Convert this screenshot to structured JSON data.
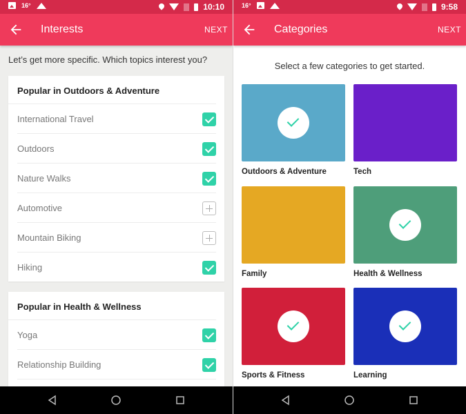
{
  "left_screen": {
    "status": {
      "temperature": "16°",
      "time": "10:10"
    },
    "appbar": {
      "title": "Interests",
      "next_label": "NEXT"
    },
    "prompt": "Let’s get more specific. Which topics interest you?",
    "sections": [
      {
        "title": "Popular in Outdoors & Adventure",
        "items": [
          {
            "label": "International Travel",
            "checked": true
          },
          {
            "label": "Outdoors",
            "checked": true
          },
          {
            "label": "Nature Walks",
            "checked": true
          },
          {
            "label": "Automotive",
            "checked": false
          },
          {
            "label": "Mountain Biking",
            "checked": false
          },
          {
            "label": "Hiking",
            "checked": true
          }
        ]
      },
      {
        "title": "Popular in Health & Wellness",
        "items": [
          {
            "label": "Yoga",
            "checked": true
          },
          {
            "label": "Relationship Building",
            "checked": true
          }
        ]
      }
    ]
  },
  "right_screen": {
    "status": {
      "temperature": "16°",
      "time": "9:58"
    },
    "appbar": {
      "title": "Categories",
      "next_label": "NEXT"
    },
    "subtitle": "Select a few categories to get started.",
    "categories": [
      {
        "label": "Outdoors & Adventure",
        "selected": true,
        "color": "#5aa9c9"
      },
      {
        "label": "Tech",
        "selected": false,
        "color": "#6a1fc9"
      },
      {
        "label": "Family",
        "selected": false,
        "color": "#e5a823"
      },
      {
        "label": "Health & Wellness",
        "selected": true,
        "color": "#4e9e7a"
      },
      {
        "label": "Sports & Fitness",
        "selected": true,
        "color": "#d11f3a"
      },
      {
        "label": "Learning",
        "selected": true,
        "color": "#1a2fb8"
      }
    ]
  },
  "colors": {
    "accent": "#ef3a5b",
    "statusbar": "#d42a4a",
    "check": "#2fd2a8"
  }
}
